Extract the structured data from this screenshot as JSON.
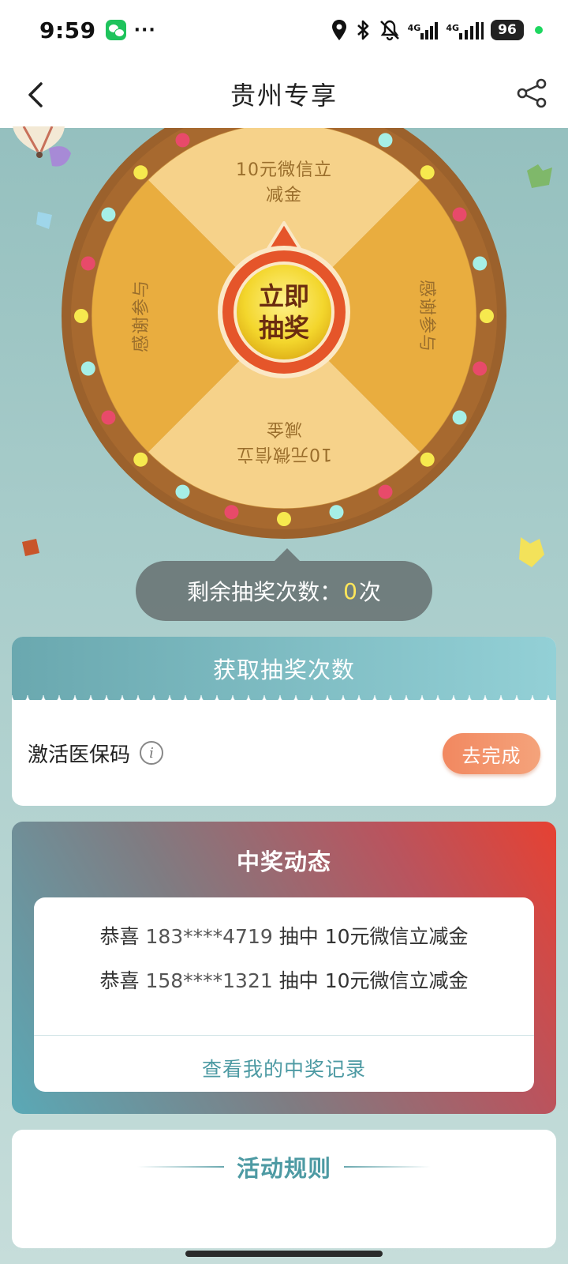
{
  "status_bar": {
    "time": "9:59",
    "more": "···",
    "battery": "96",
    "signal_1": "4G",
    "signal_2": "4G",
    "icons": [
      "wechat-icon",
      "location-icon",
      "bluetooth-icon",
      "mute-icon",
      "signal-icon",
      "battery-icon"
    ]
  },
  "nav": {
    "title": "贵州专享",
    "back_icon": "chevron-left-icon",
    "share_icon": "share-icon"
  },
  "wheel": {
    "segments": [
      {
        "label_line1": "10元微信立",
        "label_line2": "减金"
      },
      {
        "label_line1": "感谢参与",
        "label_line2": ""
      },
      {
        "label_line1": "10元微信立",
        "label_line2": "减金"
      },
      {
        "label_line1": "感谢参与",
        "label_line2": ""
      }
    ],
    "center_line1": "立即",
    "center_line2": "抽奖",
    "colors": {
      "rim": "#a0642e",
      "light": "#f6d28a",
      "dark": "#e9ad3f",
      "button": "#f5d731",
      "pointer": "#e5552a"
    }
  },
  "remaining": {
    "label": "剩余抽奖次数：",
    "count": "0",
    "unit": "次"
  },
  "get_chances": {
    "title": "获取抽奖次数",
    "task_label": "激活医保码",
    "info_icon_glyph": "i",
    "button_label": "去完成"
  },
  "winners": {
    "title": "中奖动态",
    "list": [
      {
        "prefix": "恭喜",
        "phone": "183****4719",
        "action": "抽中",
        "prize": "10元微信立减金"
      },
      {
        "prefix": "恭喜",
        "phone": "158****1321",
        "action": "抽中",
        "prize": "10元微信立减金"
      }
    ],
    "link": "查看我的中奖记录"
  },
  "rules": {
    "title": "活动规则"
  }
}
